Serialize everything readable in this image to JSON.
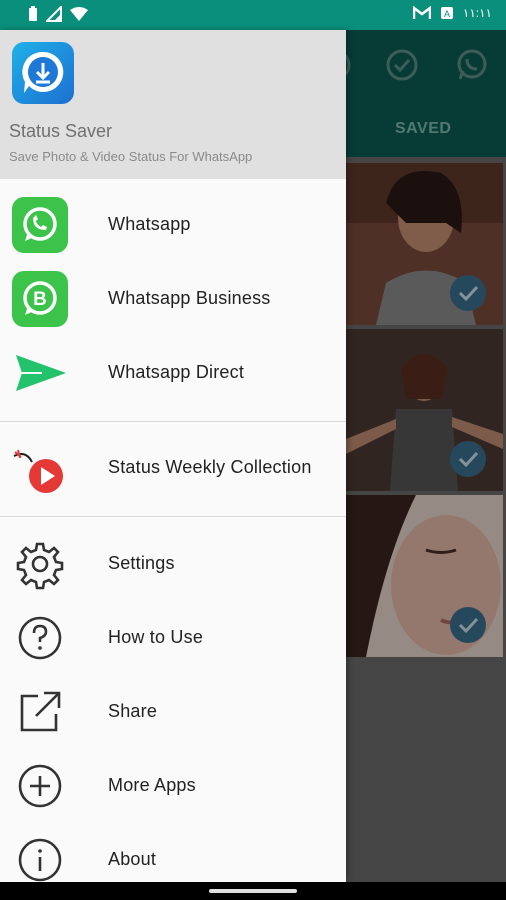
{
  "status_bar": {
    "time": "١١:١١",
    "icons_left": [
      "battery-icon",
      "signal-icon",
      "wifi-icon"
    ],
    "icons_right": [
      "gmail-icon",
      "notification-icon"
    ],
    "color": "#0a8f7c"
  },
  "background_app": {
    "header_color": "#0b5d54",
    "header_icons": [
      "image-icon",
      "check-circle-icon",
      "whatsapp-icon"
    ],
    "tab_saved": "SAVED"
  },
  "drawer": {
    "title": "Status Saver",
    "subtitle": "Save Photo & Video Status For WhatsApp",
    "items": [
      {
        "label": "Whatsapp",
        "icon": "whatsapp-icon"
      },
      {
        "label": "Whatsapp Business",
        "icon": "whatsapp-business-icon"
      },
      {
        "label": "Whatsapp Direct",
        "icon": "send-icon"
      },
      {
        "label": "Status Weekly Collection",
        "icon": "video-play-icon"
      },
      {
        "label": "Settings",
        "icon": "gear-icon"
      },
      {
        "label": "How to Use",
        "icon": "help-icon"
      },
      {
        "label": "Share",
        "icon": "share-icon"
      },
      {
        "label": "More Apps",
        "icon": "add-circle-icon"
      },
      {
        "label": "About",
        "icon": "info-icon"
      }
    ],
    "accent": "#25d366"
  }
}
